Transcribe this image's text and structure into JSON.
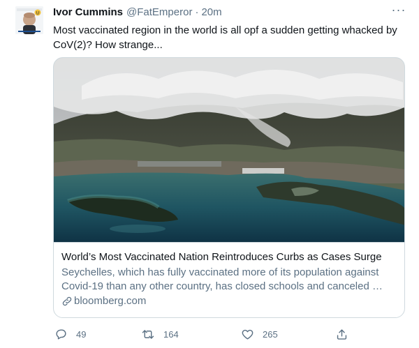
{
  "tweet": {
    "author": {
      "name": "Ivor Cummins",
      "handle": "@FatEmperor",
      "avatar_icon": "profile-photo-icon"
    },
    "separator": "·",
    "time": "20m",
    "more_label": "···",
    "text": "Most vaccinated region in the world is all opf a sudden getting whacked by CoV(2)? How strange...",
    "card": {
      "image_icon": "aerial-harbor-photo",
      "title": "World’s Most Vaccinated Nation Reintroduces Curbs as Cases Surge",
      "description": "Seychelles, which has fully vaccinated more of its population against Covid-19 than any other country, has closed schools and canceled …",
      "domain": "bloomberg.com",
      "link_icon": "link-icon"
    },
    "actions": {
      "reply_count": "49",
      "retweet_count": "164",
      "like_count": "265",
      "reply_icon": "reply-icon",
      "retweet_icon": "retweet-icon",
      "like_icon": "heart-icon",
      "share_icon": "share-icon"
    }
  },
  "colors": {
    "text_primary": "#0f1419",
    "text_secondary": "#5b7083",
    "border": "#cfd9de"
  }
}
